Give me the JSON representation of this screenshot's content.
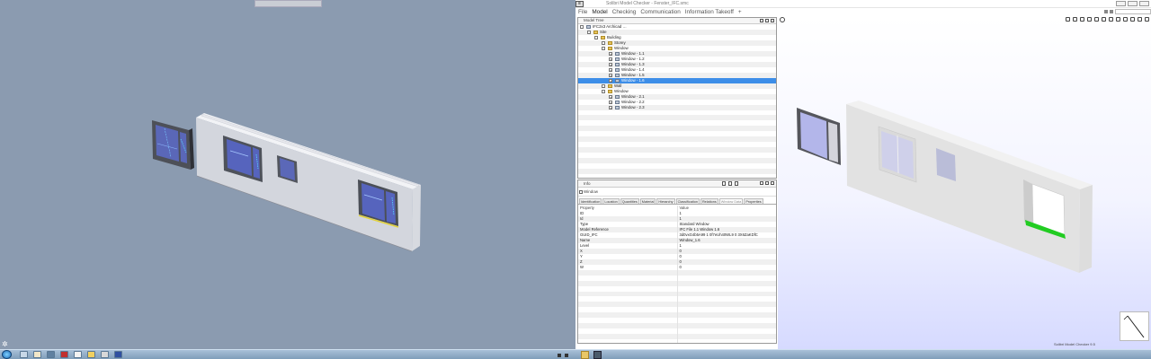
{
  "left_screen": {
    "top_strip_text": "",
    "cad_origin_glyph": "✲",
    "taskbar": {
      "start_icon": "windows-orb-icon",
      "apps": [
        {
          "name": "app-icon-1",
          "color": "#c8d8e8"
        },
        {
          "name": "app-icon-2",
          "color": "#f0e6c8"
        },
        {
          "name": "app-icon-3",
          "color": "#6080a0"
        },
        {
          "name": "app-icon-4",
          "color": "#c03030"
        },
        {
          "name": "app-icon-5",
          "color": "#f2f2f2"
        },
        {
          "name": "app-icon-6",
          "color": "#f0d060"
        },
        {
          "name": "app-icon-7",
          "color": "#d8d8d8"
        },
        {
          "name": "app-icon-8",
          "color": "#3050a0"
        }
      ],
      "clock": ""
    }
  },
  "right_screen": {
    "window_title": "Solibri Model Checker - Fenster_IFC.smc",
    "menus": [
      {
        "label": "File",
        "active": false
      },
      {
        "label": "Model",
        "active": true
      },
      {
        "label": "Checking",
        "active": false
      },
      {
        "label": "Communication",
        "active": false
      },
      {
        "label": "Information Takeoff",
        "active": false
      },
      {
        "label": "+",
        "active": false
      }
    ],
    "model_tree": {
      "title": "Model Tree",
      "rows": [
        {
          "label": "IFC2x3 Archicad …",
          "depth": 0,
          "toggle": "-",
          "kind": "obj",
          "selected": false
        },
        {
          "label": "Site",
          "depth": 1,
          "toggle": "-",
          "kind": "folder",
          "selected": false
        },
        {
          "label": "Building",
          "depth": 2,
          "toggle": "-",
          "kind": "folder",
          "selected": false
        },
        {
          "label": "Storey",
          "depth": 3,
          "toggle": "-",
          "kind": "folder",
          "selected": false
        },
        {
          "label": "Window",
          "depth": 3,
          "toggle": "-",
          "kind": "folder",
          "selected": false
        },
        {
          "label": "Window - 1.1",
          "depth": 4,
          "toggle": "+",
          "kind": "obj",
          "selected": false
        },
        {
          "label": "Window - 1.2",
          "depth": 4,
          "toggle": "+",
          "kind": "obj",
          "selected": false
        },
        {
          "label": "Window - 1.3",
          "depth": 4,
          "toggle": "+",
          "kind": "obj",
          "selected": false
        },
        {
          "label": "Window - 1.4",
          "depth": 4,
          "toggle": "+",
          "kind": "obj",
          "selected": false
        },
        {
          "label": "Window - 1.5",
          "depth": 4,
          "toggle": "+",
          "kind": "obj",
          "selected": false
        },
        {
          "label": "Window - 1.6",
          "depth": 4,
          "toggle": "+",
          "kind": "obj",
          "selected": true
        },
        {
          "label": "Wall",
          "depth": 3,
          "toggle": "-",
          "kind": "folder",
          "selected": false
        },
        {
          "label": "Window",
          "depth": 3,
          "toggle": "-",
          "kind": "folder",
          "selected": false
        },
        {
          "label": "Window - 2.1",
          "depth": 4,
          "toggle": "+",
          "kind": "obj",
          "selected": false
        },
        {
          "label": "Window - 2.2",
          "depth": 4,
          "toggle": "+",
          "kind": "obj",
          "selected": false
        },
        {
          "label": "Window - 2.3",
          "depth": 4,
          "toggle": "+",
          "kind": "obj",
          "selected": false
        }
      ],
      "empty_rows": 13
    },
    "properties": {
      "title": "Info",
      "subtitle": "Window",
      "tabs": [
        {
          "label": "Identification",
          "active": false
        },
        {
          "label": "Location",
          "active": false
        },
        {
          "label": "Quantities",
          "active": false
        },
        {
          "label": "Material",
          "active": false
        },
        {
          "label": "Hierarchy",
          "active": false
        },
        {
          "label": "Classification",
          "active": false
        },
        {
          "label": "Relations",
          "active": false
        },
        {
          "label": "Window Data",
          "active": true
        },
        {
          "label": "Properties",
          "active": false
        }
      ],
      "columns": [
        "Property",
        "Value"
      ],
      "rows": [
        [
          "ID",
          "1"
        ],
        [
          "Id",
          "1"
        ],
        [
          "Type",
          "Standard Window"
        ],
        [
          "Model Reference",
          "IFC File 1.1 Window 1.6"
        ],
        [
          "GUID_IFC",
          "3d0vxG4b5A99  1  0f7eUh40WL9  0  3X6ZaKDfC"
        ],
        [
          "Name",
          "Window_1.6"
        ],
        [
          "Level",
          "1"
        ],
        [
          "X",
          "0"
        ],
        [
          "Y",
          "0"
        ],
        [
          "Z",
          "0"
        ],
        [
          "W",
          "0"
        ]
      ],
      "empty_rows": 14
    },
    "viewport": {
      "status_text": "Solibri Model Checker 9.5",
      "highlight_color": "#22cc22"
    }
  }
}
